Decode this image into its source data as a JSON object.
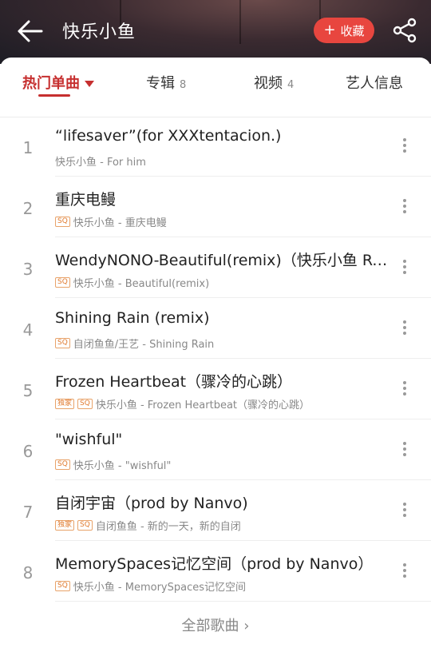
{
  "header": {
    "title": "快乐小鱼",
    "favorite_label": "收藏",
    "favorite_color": "#e8463f",
    "icons": [
      "back-arrow-icon",
      "plus-icon",
      "share-icon"
    ]
  },
  "tabs": [
    {
      "label": "热门单曲",
      "count": ""
    },
    {
      "label": "专辑",
      "count": "8"
    },
    {
      "label": "视频",
      "count": "4"
    },
    {
      "label": "艺人信息",
      "count": ""
    }
  ],
  "accent_color": "#c62f2f",
  "songs": [
    {
      "num": "1",
      "name": "“lifesaver”(for XXXtentacion.)",
      "sub": "快乐小鱼 - For him",
      "badges": []
    },
    {
      "num": "2",
      "name": "重庆电鳗",
      "sub": "快乐小鱼 - 重庆电鳗",
      "badges": [
        "SQ"
      ]
    },
    {
      "num": "3",
      "name": "WendyNONO-Beautiful(remix)（快乐小鱼 Re...",
      "sub": "快乐小鱼 - Beautiful(remix)",
      "badges": [
        "SQ"
      ]
    },
    {
      "num": "4",
      "name": "Shining Rain (remix)",
      "sub": "自闭鱼鱼/王艺 - Shining Rain",
      "badges": [
        "SQ"
      ]
    },
    {
      "num": "5",
      "name": "Frozen Heartbeat（骤冷的心跳）",
      "sub": "快乐小鱼 - Frozen Heartbeat（骤冷的心跳）",
      "badges": [
        "独家",
        "SQ"
      ]
    },
    {
      "num": "6",
      "name": "\"wishful\"",
      "sub": "快乐小鱼 - \"wishful\"",
      "badges": [
        "SQ"
      ]
    },
    {
      "num": "7",
      "name": "自闭宇宙（prod by Nanvo)",
      "sub": "自闭鱼鱼 - 新的一天，新的自闭",
      "badges": [
        "独家",
        "SQ"
      ]
    },
    {
      "num": "8",
      "name": "MemorySpaces记忆空间（prod by Nanvo）",
      "sub": "快乐小鱼 - MemorySpaces记忆空间",
      "badges": [
        "SQ"
      ]
    }
  ],
  "all_songs_label": "全部歌曲 ›"
}
